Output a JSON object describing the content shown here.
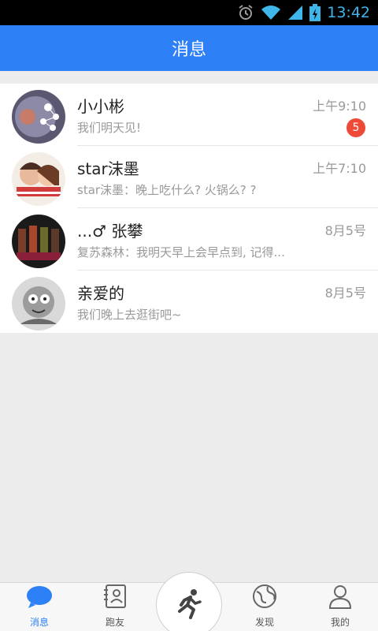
{
  "status_bar": {
    "time": "13:42"
  },
  "header": {
    "title": "消息"
  },
  "conversations": [
    {
      "name": "小小彬",
      "message": "我们明天见!",
      "time": "上午9:10",
      "unread": "5"
    },
    {
      "name": "star沫墨",
      "message": "star沫墨：晚上吃什么? 火锅么? ?",
      "time": "上午7:10"
    },
    {
      "name": "...♂ 张攀",
      "message": "复苏森林：我明天早上会早点到, 记得...",
      "time": "8月5号"
    },
    {
      "name": "亲爱的",
      "message": "我们晚上去逛街吧~",
      "time": "8月5号"
    }
  ],
  "tabs": [
    {
      "label": "消息",
      "icon": "chat-bubble-icon"
    },
    {
      "label": "跑友",
      "icon": "contacts-book-icon"
    },
    {
      "label": "发现",
      "icon": "globe-icon"
    },
    {
      "label": "我的",
      "icon": "person-icon"
    }
  ],
  "center_action": {
    "icon": "runner-icon"
  },
  "colors": {
    "accent": "#2d80f6",
    "badge": "#ef4a37"
  }
}
